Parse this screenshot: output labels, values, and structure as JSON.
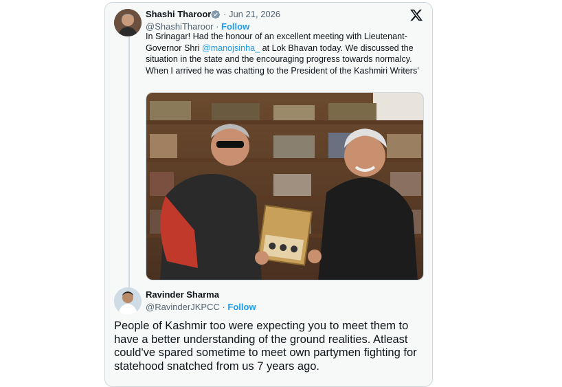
{
  "tweet": {
    "author_name": "Shashi Tharoor",
    "verified_icon": "verified-badge-icon",
    "date": "· Jun 21, 2026",
    "handle": "@ShashiTharoor · ",
    "follow_label": "Follow",
    "text_part1": "In Srinagar! Had the honour of an excellent meeting with Lieutenant-Governor Shri ",
    "mention": "@manojsinha_",
    "text_part2": " at Lok Bhavan today. We discussed the situation in the state and the encouraging progress towards normalcy. When I arrived he was chatting to the President of the Kashmiri Writers'",
    "platform_icon": "x-logo-icon",
    "photo_icon": "tweet-photo"
  },
  "reply": {
    "author_name": "Ravinder Sharma",
    "handle": "@RavinderJKPCC · ",
    "follow_label": "Follow",
    "text": "People of Kashmir too were expecting you to meet them to have a better understanding of the ground realities. Atleast could've spared sometime to meet  own partymen fighting for statehood snatched from us 7 years ago."
  },
  "colors": {
    "accent": "#1d9bf0",
    "text": "#0f1419",
    "muted": "#536471",
    "border": "#cfd9de",
    "card_bg": "#f7f9f9"
  }
}
